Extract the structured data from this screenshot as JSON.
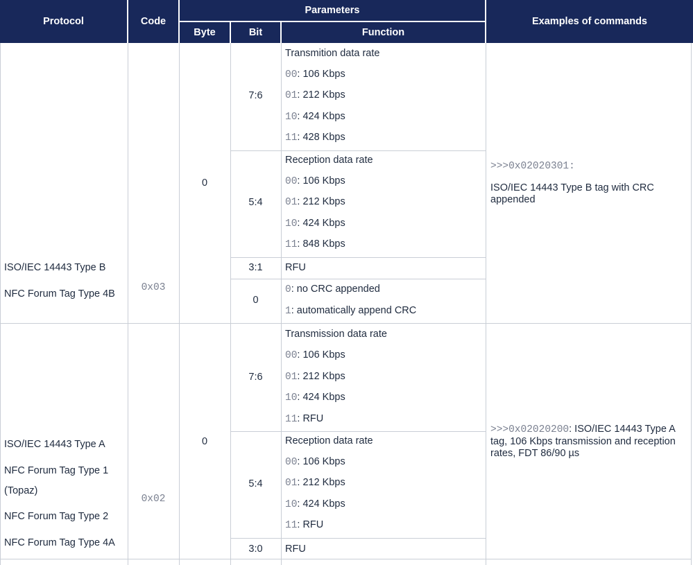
{
  "headers": {
    "protocol": "Protocol",
    "code": "Code",
    "parameters": "Parameters",
    "byte": "Byte",
    "bit": "Bit",
    "function": "Function",
    "examples": "Examples of commands"
  },
  "rows": [
    {
      "protocols": [
        "ISO/IEC 14443 Type B",
        "NFC Forum Tag Type 4B"
      ],
      "code": "0x03",
      "byte": "0",
      "bits": [
        {
          "bit": "7:6",
          "title": "Transmition data rate",
          "options": [
            {
              "code": "00",
              "text": ": 106 Kbps"
            },
            {
              "code": "01",
              "text": ": 212 Kbps"
            },
            {
              "code": "10",
              "text": ": 424 Kbps"
            },
            {
              "code": "11",
              "text": ": 428 Kbps"
            }
          ]
        },
        {
          "bit": "5:4",
          "title": "Reception data rate",
          "options": [
            {
              "code": "00",
              "text": ": 106 Kbps"
            },
            {
              "code": "01",
              "text": ": 212 Kbps"
            },
            {
              "code": "10",
              "text": ": 424 Kbps"
            },
            {
              "code": "11",
              "text": ": 848 Kbps"
            }
          ]
        },
        {
          "bit": "3:1",
          "title": "RFU"
        },
        {
          "bit": "0",
          "options": [
            {
              "code": "0",
              "text": ": no CRC appended"
            },
            {
              "code": "1",
              "text": ": automatically append CRC"
            }
          ]
        }
      ],
      "example_cmd": ">>>0x02020301:",
      "example_text": "ISO/IEC 14443 Type B tag with CRC appended"
    },
    {
      "protocols": [
        "ISO/IEC 14443 Type A",
        "NFC Forum Tag Type 1",
        "(Topaz)",
        "NFC Forum Tag Type 2",
        "NFC Forum Tag Type 4A"
      ],
      "code": "0x02",
      "byte": "0",
      "bits": [
        {
          "bit": "7:6",
          "title": "Transmission data rate",
          "options": [
            {
              "code": "00",
              "text": ": 106 Kbps"
            },
            {
              "code": "01",
              "text": ": 212 Kbps"
            },
            {
              "code": "10",
              "text": ": 424 Kbps"
            },
            {
              "code": "11",
              "text": ": RFU"
            }
          ]
        },
        {
          "bit": "5:4",
          "title": "Reception data rate",
          "options": [
            {
              "code": "00",
              "text": ": 106 Kbps"
            },
            {
              "code": "01",
              "text": ": 212 Kbps"
            },
            {
              "code": "10",
              "text": ": 424 Kbps"
            },
            {
              "code": "11",
              "text": ": RFU"
            }
          ]
        },
        {
          "bit": "3:0",
          "title": "RFU"
        }
      ],
      "example_cmd": ">>>0x02020200",
      "example_text": ": ISO/IEC 14443 Type A tag, 106 Kbps transmission and reception rates, FDT 86/90 µs"
    }
  ]
}
